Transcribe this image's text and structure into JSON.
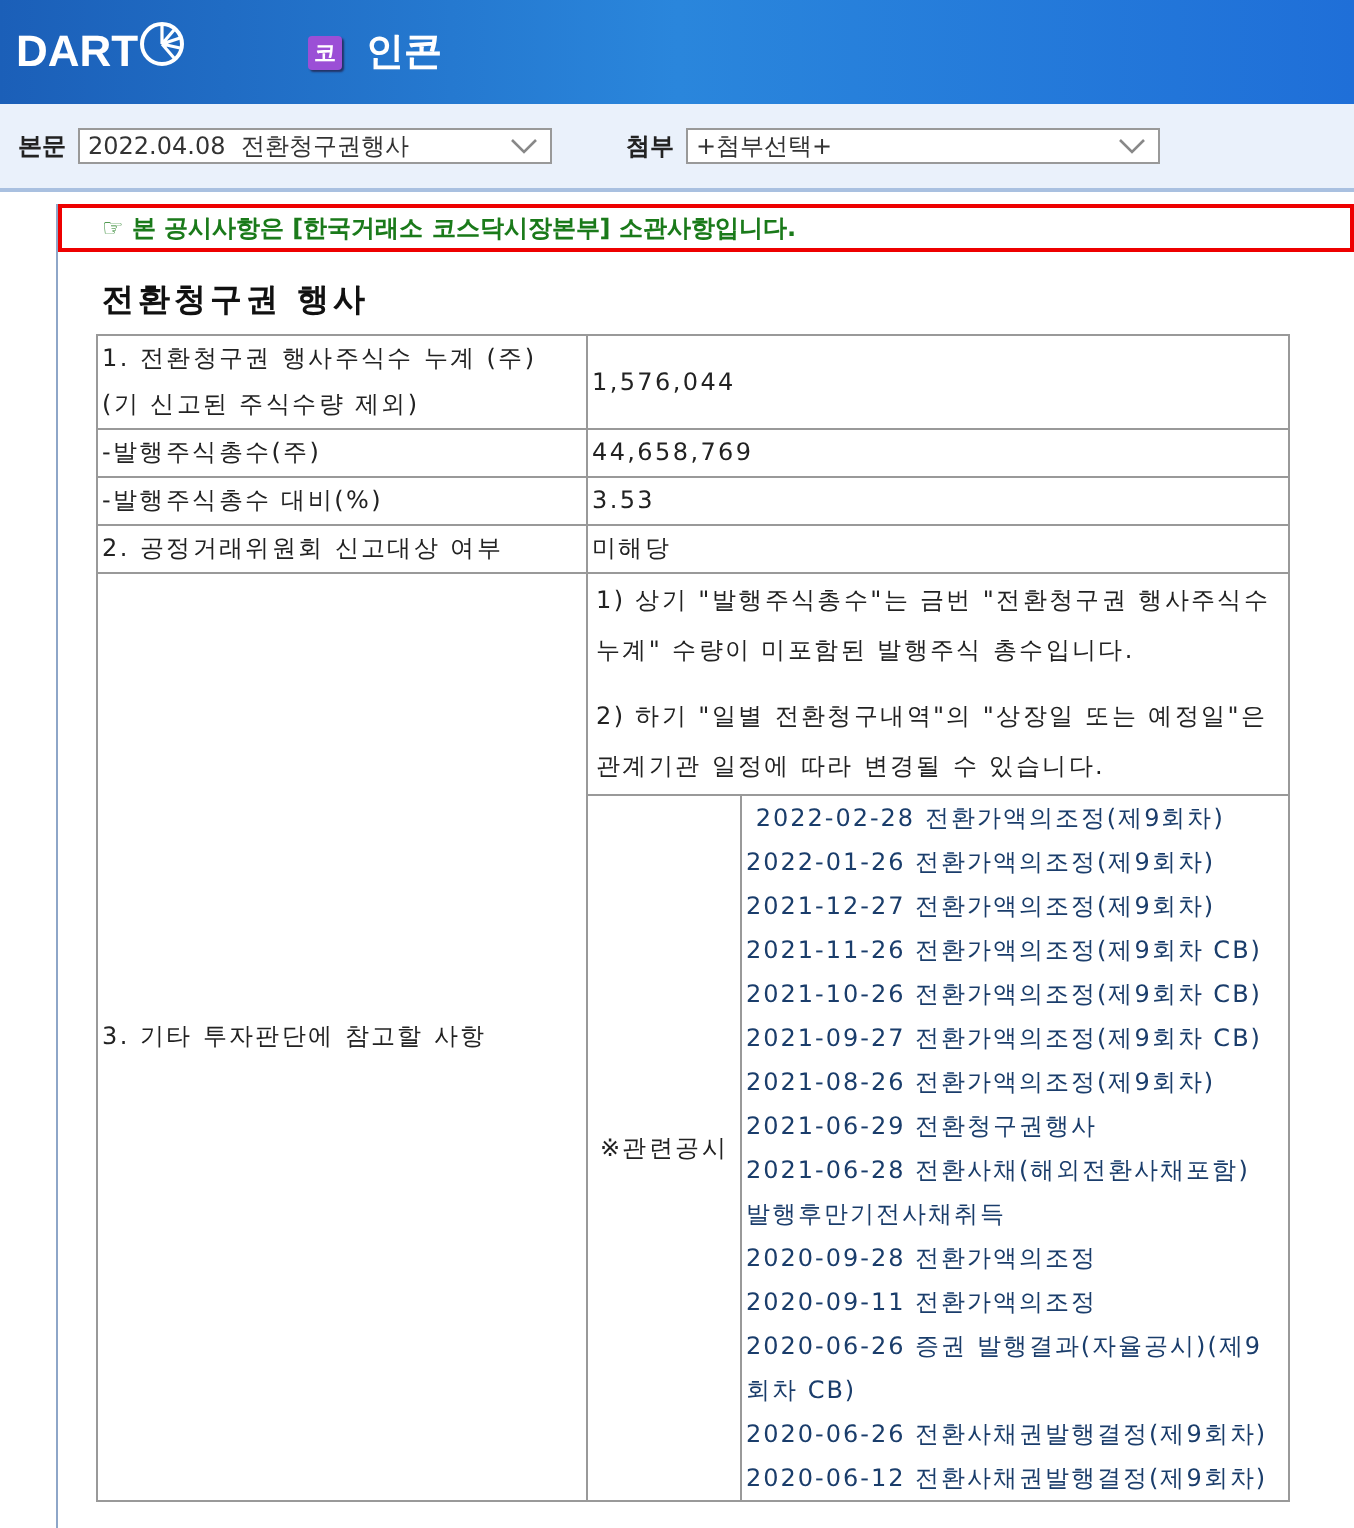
{
  "header": {
    "logo": "DART",
    "company_badge": "코",
    "company_name": "인콘"
  },
  "toolbar": {
    "main_label": "본문",
    "main_select": "2022.04.08  전환청구권행사",
    "attach_label": "첨부",
    "attach_select": "+첨부선택+"
  },
  "notice": {
    "icon": "☞",
    "text": "본 공시사항은 [한국거래소 코스닥시장본부] 소관사항입니다."
  },
  "title": "전환청구권 행사",
  "rows": [
    {
      "label_lines": [
        "1. 전환청구권 행사주식수 누계 (주)",
        "(기 신고된 주식수량 제외)"
      ],
      "value": "1,576,044"
    },
    {
      "label_lines": [
        "-발행주식총수(주)"
      ],
      "value": "44,658,769"
    },
    {
      "label_lines": [
        "-발행주식총수 대비(%)"
      ],
      "value": "3.53"
    },
    {
      "label_lines": [
        "2. 공정거래위원회 신고대상 여부"
      ],
      "value": "미해당"
    }
  ],
  "other": {
    "label": "3. 기타 투자판단에 참고할 사항",
    "notes": [
      "1) 상기 \"발행주식총수\"는 금번 \"전환청구권 행사주식수 누계\" 수량이 미포함된 발행주식 총수입니다.",
      "2) 하기 \"일별 전환청구내역\"의 \"상장일 또는 예정일\"은 관계기관 일정에 따라 변경될 수 있습니다."
    ],
    "related_label": "※관련공시",
    "related": [
      " 2022-02-28 전환가액의조정(제9회차)",
      "2022-01-26 전환가액의조정(제9회차)",
      "2021-12-27 전환가액의조정(제9회차)",
      "2021-11-26 전환가액의조정(제9회차 CB)",
      "2021-10-26 전환가액의조정(제9회차 CB)",
      "2021-09-27 전환가액의조정(제9회차 CB)",
      "2021-08-26 전환가액의조정(제9회차)",
      "2021-06-29 전환청구권행사",
      "2021-06-28 전환사채(해외전환사채포함) 발행후만기전사채취득",
      "2020-09-28 전환가액의조정",
      "2020-09-11 전환가액의조정",
      "2020-06-26 증권 발행결과(자율공시)(제9회차 CB)",
      "2020-06-26 전환사채권발행결정(제9회차)",
      "2020-06-12 전환사채권발행결정(제9회차)"
    ]
  }
}
